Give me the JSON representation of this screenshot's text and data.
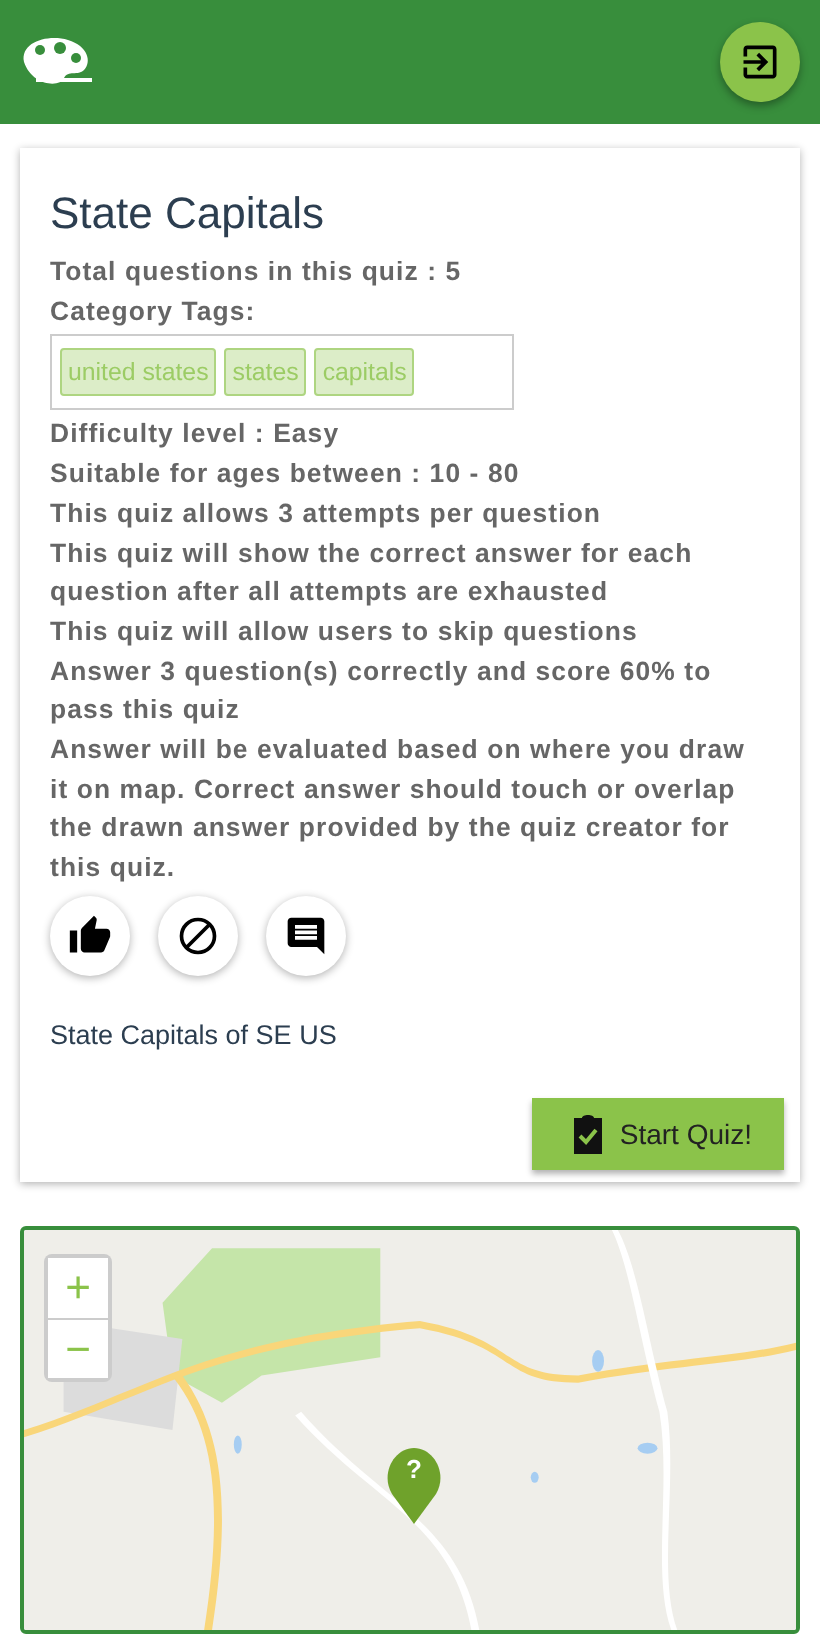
{
  "quiz": {
    "title": "State Capitals",
    "total_questions": "Total questions in this quiz : 5",
    "tags_label": "Category Tags:",
    "tags": [
      "united states",
      "states",
      "capitals"
    ],
    "rules": [
      "Difficulty level : Easy",
      "Suitable for ages between : 10 - 80",
      "This quiz allows 3 attempts per question",
      "This quiz will show the correct answer for each question after all attempts are exhausted",
      "This quiz will allow users to skip questions",
      "Answer 3 question(s) correctly and score 60% to pass this quiz",
      "Answer will be evaluated based on where you draw it on map. Correct answer should touch or overlap the drawn answer provided by the quiz creator for this quiz."
    ],
    "actions": [
      {
        "kind": "like"
      },
      {
        "kind": "block"
      },
      {
        "kind": "comment"
      }
    ],
    "description": "State Capitals of SE US",
    "start_button": "Start Quiz!"
  },
  "map": {
    "zoom_in": "+",
    "zoom_out": "−",
    "marker": "?"
  }
}
